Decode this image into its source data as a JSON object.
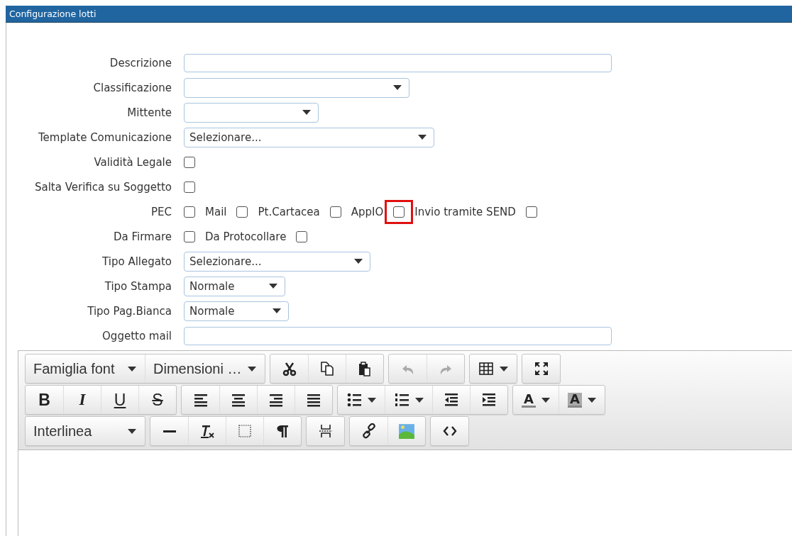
{
  "window": {
    "title": "Configurazione lotti"
  },
  "form": [
    {
      "label": "Descrizione",
      "kind": "text"
    },
    {
      "label": "Classificazione",
      "kind": "select"
    },
    {
      "label": "Mittente",
      "kind": "select"
    },
    {
      "label": "Template Comunicazione",
      "kind": "select",
      "value": "Selezionare..."
    },
    {
      "label": "Validità Legale",
      "kind": "checks",
      "items": [
        {
          "checked": false,
          "highlighted": false
        }
      ]
    },
    {
      "label": "Salta Verifica su Soggetto",
      "kind": "checks",
      "items": [
        {
          "checked": false,
          "highlighted": false
        }
      ]
    },
    {
      "label": "PEC",
      "kind": "checks",
      "items": [
        {
          "checked": false,
          "highlighted": false
        },
        {
          "label": "Mail",
          "checked": false,
          "highlighted": false
        },
        {
          "label": "Pt.Cartacea",
          "checked": false,
          "highlighted": false
        },
        {
          "label": "AppIO",
          "checked": false,
          "highlighted": true
        },
        {
          "label": "Invio tramite SEND",
          "checked": false,
          "highlighted": false
        }
      ]
    },
    {
      "label": "Da Firmare",
      "kind": "checks",
      "items": [
        {
          "checked": false,
          "highlighted": false
        },
        {
          "label": "Da Protocollare",
          "checked": false,
          "highlighted": false
        }
      ]
    },
    {
      "label": "Tipo Allegato",
      "kind": "select",
      "value": "Selezionare..."
    },
    {
      "label": "Tipo Stampa",
      "kind": "select",
      "value": "Normale"
    },
    {
      "label": "Tipo Pag.Bianca",
      "kind": "select",
      "value": "Normale"
    },
    {
      "label": "Oggetto mail",
      "kind": "text"
    }
  ],
  "editor": {
    "toolbar_rows": [
      [
        [
          {
            "kind": "dropdown",
            "label": "Famiglia font"
          },
          {
            "kind": "dropdown",
            "label": "Dimensioni …"
          }
        ],
        [
          {
            "kind": "cut"
          },
          {
            "kind": "copy"
          },
          {
            "kind": "paste"
          }
        ],
        [
          {
            "kind": "undo",
            "disabled": true
          },
          {
            "kind": "redo",
            "disabled": true
          }
        ],
        [
          {
            "kind": "table"
          }
        ],
        [
          {
            "kind": "fullscreen"
          }
        ]
      ],
      [
        [
          {
            "kind": "bold",
            "text": "B"
          },
          {
            "kind": "italic",
            "text": "I"
          },
          {
            "kind": "underline",
            "text": "U"
          },
          {
            "kind": "strike",
            "text": "S"
          }
        ],
        [
          {
            "kind": "align-left"
          },
          {
            "kind": "align-center"
          },
          {
            "kind": "align-right"
          },
          {
            "kind": "justify"
          }
        ],
        [
          {
            "kind": "bullets"
          },
          {
            "kind": "numbers"
          },
          {
            "kind": "outdent"
          },
          {
            "kind": "indent"
          }
        ],
        [
          {
            "kind": "text-color",
            "text": "A"
          },
          {
            "kind": "back-color",
            "text": "A"
          }
        ]
      ],
      [
        [
          {
            "kind": "dropdown",
            "label": "Interlinea"
          }
        ],
        [
          {
            "kind": "rule"
          },
          {
            "kind": "clear"
          },
          {
            "kind": "blocks"
          },
          {
            "kind": "pilcrow"
          }
        ],
        [
          {
            "kind": "pagebreak"
          }
        ],
        [
          {
            "kind": "link"
          },
          {
            "kind": "image"
          }
        ],
        [
          {
            "kind": "code"
          }
        ]
      ]
    ]
  }
}
